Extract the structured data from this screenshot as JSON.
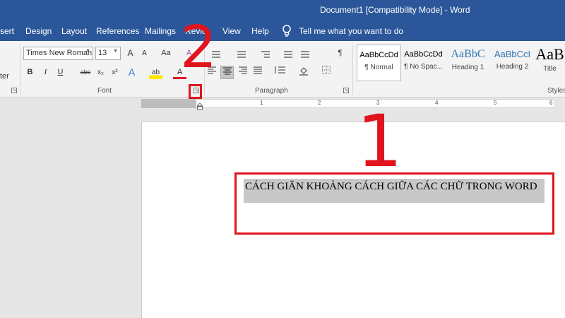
{
  "window": {
    "title": "Document1 [Compatibility Mode]  -  Word",
    "accent": "#2b579a"
  },
  "tabs": [
    {
      "label": "sert"
    },
    {
      "label": "Design"
    },
    {
      "label": "Layout"
    },
    {
      "label": "References"
    },
    {
      "label": "Mailings"
    },
    {
      "label": "Revie"
    },
    {
      "label": "View"
    },
    {
      "label": "Help"
    }
  ],
  "tell_me": {
    "label": "Tell me what you want to do",
    "icon": "lightbulb-icon"
  },
  "clipboard": {
    "partial_label": "ter"
  },
  "font": {
    "font_name": "Times New Roman",
    "font_size": "13",
    "group_label": "Font",
    "buttons": {
      "bold": "B",
      "italic": "I",
      "underline": "U",
      "strike": "abc",
      "subscript": "x₂",
      "superscript": "x²",
      "grow": "A",
      "shrink": "A",
      "case": "Aa",
      "highlight": "ab",
      "color": "A",
      "effects": "A"
    }
  },
  "paragraph": {
    "group_label": "Paragraph",
    "show_marks": "¶"
  },
  "styles": {
    "group_label": "Styles",
    "items": [
      {
        "preview": "AaBbCcDd",
        "name": "¶ Normal"
      },
      {
        "preview": "AaBbCcDd",
        "name": "¶ No Spac..."
      },
      {
        "preview": "AaBbC",
        "name": "Heading 1"
      },
      {
        "preview": "AaBbCcI",
        "name": "Heading 2"
      },
      {
        "preview": "AaB",
        "name": "Title"
      }
    ]
  },
  "ruler": {
    "numbers": [
      "1",
      "1",
      "2",
      "3",
      "4",
      "5",
      "6"
    ]
  },
  "document": {
    "selected_text": "CÁCH GIÃN KHOẢNG CÁCH GIỮA CÁC CHỮ TRONG WORD"
  },
  "annotations": {
    "step1": "1",
    "step2": "2",
    "color": "#e0141e"
  }
}
